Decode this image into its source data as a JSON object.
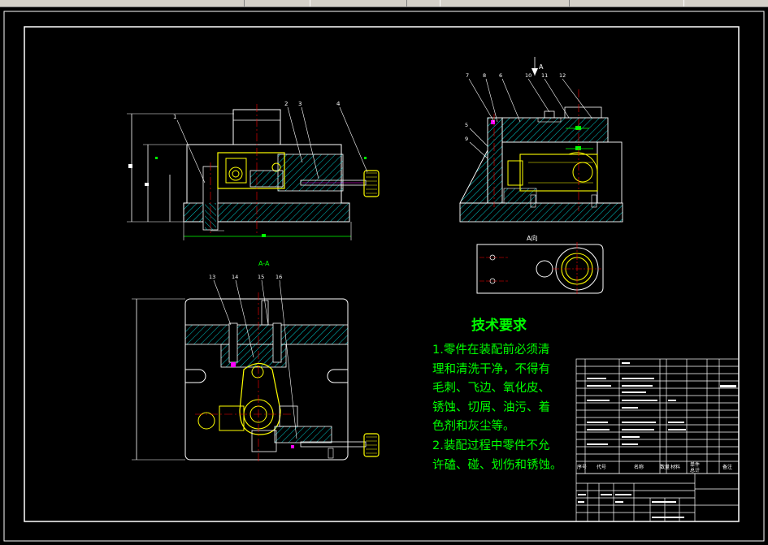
{
  "colors": {
    "background": "#000000",
    "frame": "#ffffff",
    "part_yellow": "#ffff00",
    "hatch_cyan": "#00c8c8",
    "dim_green": "#00ff00",
    "center_red": "#ff0000",
    "dim_magenta": "#ff00ff"
  },
  "views": {
    "section_label": "A-A",
    "arrow_label": "A",
    "view_a_label": "A向"
  },
  "balloons": {
    "front": [
      "1",
      "2",
      "3",
      "4"
    ],
    "side": [
      "7",
      "8",
      "6",
      "10",
      "11",
      "12",
      "5",
      "9"
    ],
    "top": [
      "13",
      "14",
      "15",
      "16"
    ]
  },
  "tech_requirements": {
    "title": "技术要求",
    "lines": [
      "1.零件在装配前必须清",
      "理和清洗干净，不得有",
      "毛刺、飞边、氧化皮、",
      "锈蚀、切屑、油污、着",
      "色剂和灰尘等。",
      "2.装配过程中零件不允",
      "许磕、碰、划伤和锈蚀。"
    ]
  },
  "title_block": {
    "headers": [
      "序号",
      "代号",
      "名称",
      "数量",
      "材料",
      "单件",
      "总计",
      "备注"
    ]
  }
}
